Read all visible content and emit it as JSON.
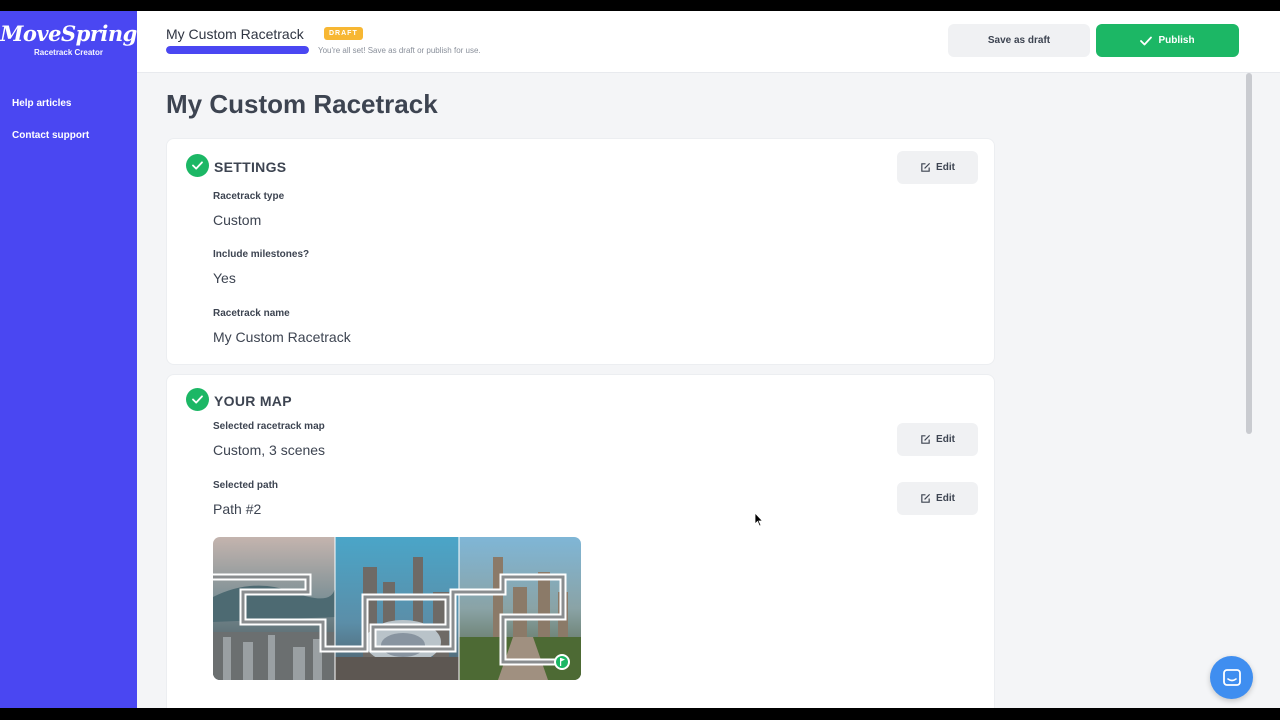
{
  "brand": {
    "name": "MoveSpring",
    "subtitle": "Racetrack Creator"
  },
  "sidebar": {
    "links": [
      {
        "label": "Help articles"
      },
      {
        "label": "Contact support"
      }
    ]
  },
  "topbar": {
    "title": "My Custom Racetrack",
    "badge": "DRAFT",
    "progress_percent": 100,
    "progress_message": "You're all set! Save as draft or publish for use.",
    "save_draft_label": "Save as draft",
    "publish_label": "Publish"
  },
  "main": {
    "title": "My Custom Racetrack",
    "settings": {
      "title": "SETTINGS",
      "edit_label": "Edit",
      "fields": [
        {
          "label": "Racetrack type",
          "value": "Custom"
        },
        {
          "label": "Include milestones?",
          "value": "Yes"
        },
        {
          "label": "Racetrack name",
          "value": "My Custom Racetrack"
        }
      ]
    },
    "map": {
      "title": "YOUR MAP",
      "fields": [
        {
          "label": "Selected racetrack map",
          "value": "Custom, 3 scenes",
          "edit_label": "Edit"
        },
        {
          "label": "Selected path",
          "value": "Path #2",
          "edit_label": "Edit"
        }
      ]
    }
  },
  "colors": {
    "sidebar": "#4a47f2",
    "accent_green": "#1cb765",
    "draft_badge": "#f7b733",
    "chat": "#3f8ef0"
  },
  "icons": [
    "check-icon",
    "edit-icon",
    "chat-icon",
    "flag-icon"
  ]
}
